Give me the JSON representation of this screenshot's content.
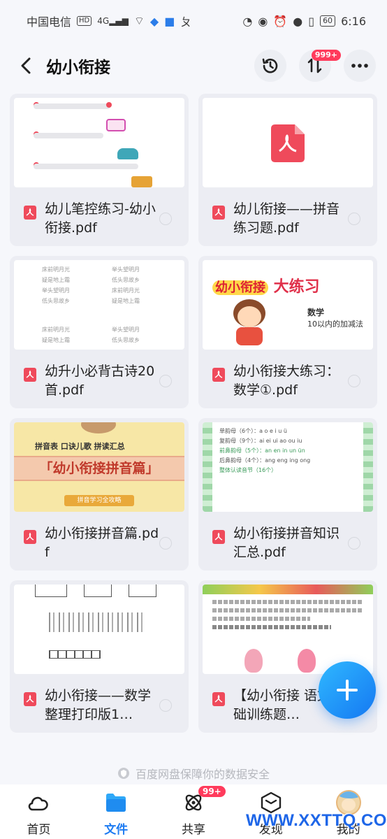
{
  "status_bar": {
    "carrier": "中国电信",
    "hd": "HD",
    "signal": "4G",
    "battery": "60",
    "time": "6:16"
  },
  "header": {
    "title": "幼小衔接",
    "transfer_badge": "999+"
  },
  "files": [
    {
      "name": "幼儿笔控练习-幼小衔接.pdf"
    },
    {
      "name": "幼儿衔接——拼音练习题.pdf"
    },
    {
      "name": "幼升小必背古诗20首.pdf"
    },
    {
      "name": "幼小衔接大练习：数学①.pdf"
    },
    {
      "name": "幼小衔接拼音篇.pdf"
    },
    {
      "name": "幼小衔接拼音知识汇总.pdf"
    },
    {
      "name": "幼小衔接——数学整理打印版1…"
    },
    {
      "name": "【幼小衔接 语文基础训练题…"
    }
  ],
  "thumbnails": {
    "math_title_a": "幼小衔接",
    "math_title_b": "大练习",
    "math_subject": "数学",
    "math_sub": "10以内的加减法",
    "pinyin_tags": "拼音表  口诀儿歌  拼读汇总",
    "pinyin_banner": "「幼小衔接拼音篇」",
    "pinyin_btn": "拼音学习全攻略",
    "know_lines": [
      "单韵母（6个）：a o e i u ü",
      "复韵母（9个）：ai ei ui ao ou iu",
      "前鼻韵母（5个）：an en in un ün",
      "后鼻韵母（4个）：ang eng ing ong",
      "整体认读音节（16个）"
    ],
    "poem_lines": [
      "床前明月光",
      "疑是地上霜",
      "举头望明月",
      "低头思故乡"
    ]
  },
  "safety_note": "百度网盘保障你的数据安全",
  "nav": {
    "home": "首页",
    "files": "文件",
    "share": "共享",
    "discover": "发现",
    "me": "我的",
    "share_badge": "99+"
  },
  "watermark": "WWW.XXTTQ.COM",
  "colors": {
    "accent": "#1f7cf2",
    "badge": "#ff3b5c",
    "pdf": "#ef4a5b"
  }
}
